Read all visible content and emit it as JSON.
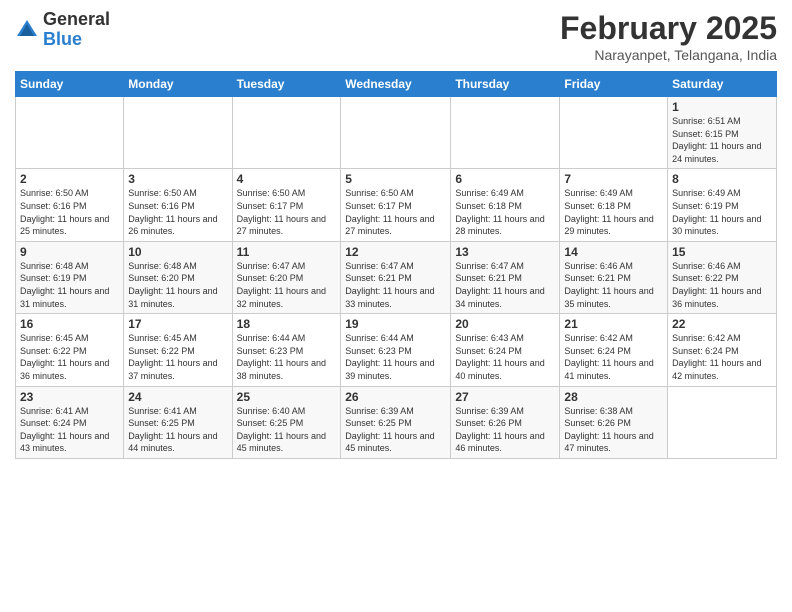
{
  "header": {
    "logo_general": "General",
    "logo_blue": "Blue",
    "month_title": "February 2025",
    "location": "Narayanpet, Telangana, India"
  },
  "weekdays": [
    "Sunday",
    "Monday",
    "Tuesday",
    "Wednesday",
    "Thursday",
    "Friday",
    "Saturday"
  ],
  "weeks": [
    [
      {
        "day": "",
        "sunrise": "",
        "sunset": "",
        "daylight": ""
      },
      {
        "day": "",
        "sunrise": "",
        "sunset": "",
        "daylight": ""
      },
      {
        "day": "",
        "sunrise": "",
        "sunset": "",
        "daylight": ""
      },
      {
        "day": "",
        "sunrise": "",
        "sunset": "",
        "daylight": ""
      },
      {
        "day": "",
        "sunrise": "",
        "sunset": "",
        "daylight": ""
      },
      {
        "day": "",
        "sunrise": "",
        "sunset": "",
        "daylight": ""
      },
      {
        "day": "1",
        "sunrise": "Sunrise: 6:51 AM",
        "sunset": "Sunset: 6:15 PM",
        "daylight": "Daylight: 11 hours and 24 minutes."
      }
    ],
    [
      {
        "day": "2",
        "sunrise": "Sunrise: 6:50 AM",
        "sunset": "Sunset: 6:16 PM",
        "daylight": "Daylight: 11 hours and 25 minutes."
      },
      {
        "day": "3",
        "sunrise": "Sunrise: 6:50 AM",
        "sunset": "Sunset: 6:16 PM",
        "daylight": "Daylight: 11 hours and 26 minutes."
      },
      {
        "day": "4",
        "sunrise": "Sunrise: 6:50 AM",
        "sunset": "Sunset: 6:17 PM",
        "daylight": "Daylight: 11 hours and 27 minutes."
      },
      {
        "day": "5",
        "sunrise": "Sunrise: 6:50 AM",
        "sunset": "Sunset: 6:17 PM",
        "daylight": "Daylight: 11 hours and 27 minutes."
      },
      {
        "day": "6",
        "sunrise": "Sunrise: 6:49 AM",
        "sunset": "Sunset: 6:18 PM",
        "daylight": "Daylight: 11 hours and 28 minutes."
      },
      {
        "day": "7",
        "sunrise": "Sunrise: 6:49 AM",
        "sunset": "Sunset: 6:18 PM",
        "daylight": "Daylight: 11 hours and 29 minutes."
      },
      {
        "day": "8",
        "sunrise": "Sunrise: 6:49 AM",
        "sunset": "Sunset: 6:19 PM",
        "daylight": "Daylight: 11 hours and 30 minutes."
      }
    ],
    [
      {
        "day": "9",
        "sunrise": "Sunrise: 6:48 AM",
        "sunset": "Sunset: 6:19 PM",
        "daylight": "Daylight: 11 hours and 31 minutes."
      },
      {
        "day": "10",
        "sunrise": "Sunrise: 6:48 AM",
        "sunset": "Sunset: 6:20 PM",
        "daylight": "Daylight: 11 hours and 31 minutes."
      },
      {
        "day": "11",
        "sunrise": "Sunrise: 6:47 AM",
        "sunset": "Sunset: 6:20 PM",
        "daylight": "Daylight: 11 hours and 32 minutes."
      },
      {
        "day": "12",
        "sunrise": "Sunrise: 6:47 AM",
        "sunset": "Sunset: 6:21 PM",
        "daylight": "Daylight: 11 hours and 33 minutes."
      },
      {
        "day": "13",
        "sunrise": "Sunrise: 6:47 AM",
        "sunset": "Sunset: 6:21 PM",
        "daylight": "Daylight: 11 hours and 34 minutes."
      },
      {
        "day": "14",
        "sunrise": "Sunrise: 6:46 AM",
        "sunset": "Sunset: 6:21 PM",
        "daylight": "Daylight: 11 hours and 35 minutes."
      },
      {
        "day": "15",
        "sunrise": "Sunrise: 6:46 AM",
        "sunset": "Sunset: 6:22 PM",
        "daylight": "Daylight: 11 hours and 36 minutes."
      }
    ],
    [
      {
        "day": "16",
        "sunrise": "Sunrise: 6:45 AM",
        "sunset": "Sunset: 6:22 PM",
        "daylight": "Daylight: 11 hours and 36 minutes."
      },
      {
        "day": "17",
        "sunrise": "Sunrise: 6:45 AM",
        "sunset": "Sunset: 6:22 PM",
        "daylight": "Daylight: 11 hours and 37 minutes."
      },
      {
        "day": "18",
        "sunrise": "Sunrise: 6:44 AM",
        "sunset": "Sunset: 6:23 PM",
        "daylight": "Daylight: 11 hours and 38 minutes."
      },
      {
        "day": "19",
        "sunrise": "Sunrise: 6:44 AM",
        "sunset": "Sunset: 6:23 PM",
        "daylight": "Daylight: 11 hours and 39 minutes."
      },
      {
        "day": "20",
        "sunrise": "Sunrise: 6:43 AM",
        "sunset": "Sunset: 6:24 PM",
        "daylight": "Daylight: 11 hours and 40 minutes."
      },
      {
        "day": "21",
        "sunrise": "Sunrise: 6:42 AM",
        "sunset": "Sunset: 6:24 PM",
        "daylight": "Daylight: 11 hours and 41 minutes."
      },
      {
        "day": "22",
        "sunrise": "Sunrise: 6:42 AM",
        "sunset": "Sunset: 6:24 PM",
        "daylight": "Daylight: 11 hours and 42 minutes."
      }
    ],
    [
      {
        "day": "23",
        "sunrise": "Sunrise: 6:41 AM",
        "sunset": "Sunset: 6:24 PM",
        "daylight": "Daylight: 11 hours and 43 minutes."
      },
      {
        "day": "24",
        "sunrise": "Sunrise: 6:41 AM",
        "sunset": "Sunset: 6:25 PM",
        "daylight": "Daylight: 11 hours and 44 minutes."
      },
      {
        "day": "25",
        "sunrise": "Sunrise: 6:40 AM",
        "sunset": "Sunset: 6:25 PM",
        "daylight": "Daylight: 11 hours and 45 minutes."
      },
      {
        "day": "26",
        "sunrise": "Sunrise: 6:39 AM",
        "sunset": "Sunset: 6:25 PM",
        "daylight": "Daylight: 11 hours and 45 minutes."
      },
      {
        "day": "27",
        "sunrise": "Sunrise: 6:39 AM",
        "sunset": "Sunset: 6:26 PM",
        "daylight": "Daylight: 11 hours and 46 minutes."
      },
      {
        "day": "28",
        "sunrise": "Sunrise: 6:38 AM",
        "sunset": "Sunset: 6:26 PM",
        "daylight": "Daylight: 11 hours and 47 minutes."
      },
      {
        "day": "",
        "sunrise": "",
        "sunset": "",
        "daylight": ""
      }
    ]
  ]
}
